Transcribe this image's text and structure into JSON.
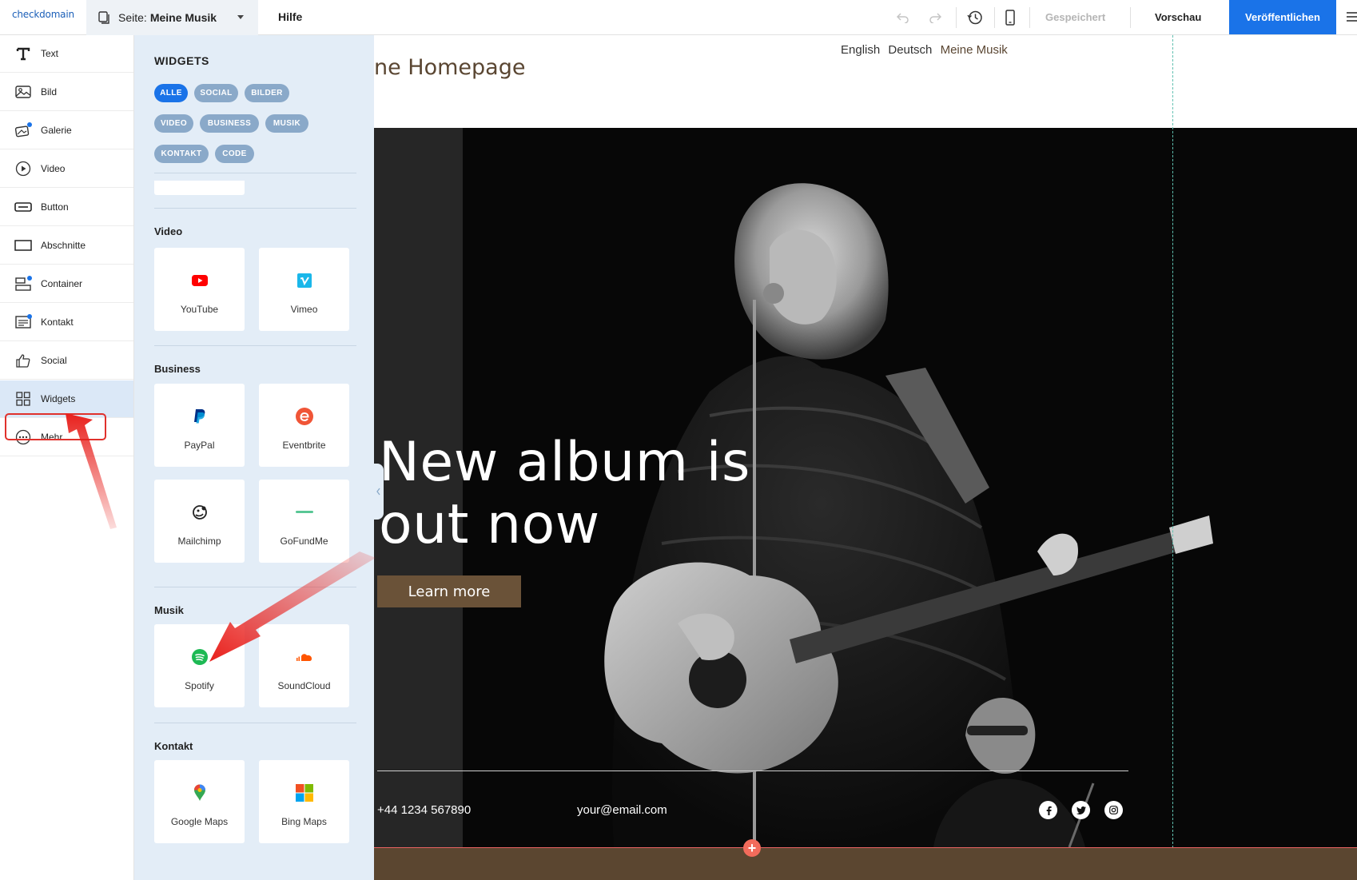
{
  "topbar": {
    "logo": "checkdomain",
    "page_label": "Seite:",
    "page_name": "Meine Musik",
    "help": "Hilfe",
    "saved": "Gespeichert",
    "preview": "Vorschau",
    "publish": "Veröffentlichen"
  },
  "sidebar": {
    "items": [
      {
        "label": "Text",
        "icon": "text-icon"
      },
      {
        "label": "Bild",
        "icon": "image-icon"
      },
      {
        "label": "Galerie",
        "icon": "gallery-icon"
      },
      {
        "label": "Video",
        "icon": "video-icon"
      },
      {
        "label": "Button",
        "icon": "button-icon"
      },
      {
        "label": "Abschnitte",
        "icon": "section-icon"
      },
      {
        "label": "Container",
        "icon": "container-icon"
      },
      {
        "label": "Kontakt",
        "icon": "contact-icon"
      },
      {
        "label": "Social",
        "icon": "thumbs-up-icon"
      },
      {
        "label": "Widgets",
        "icon": "widgets-icon"
      },
      {
        "label": "Mehr",
        "icon": "more-icon"
      }
    ]
  },
  "panel": {
    "title": "WIDGETS",
    "filters": [
      "ALLE",
      "SOCIAL",
      "BILDER",
      "VIDEO",
      "BUSINESS",
      "MUSIK",
      "KONTAKT",
      "CODE"
    ],
    "categories": {
      "video": {
        "title": "Video",
        "items": [
          "YouTube",
          "Vimeo"
        ]
      },
      "business": {
        "title": "Business",
        "items": [
          "PayPal",
          "Eventbrite",
          "Mailchimp",
          "GoFundMe"
        ]
      },
      "musik": {
        "title": "Musik",
        "items": [
          "Spotify",
          "SoundCloud"
        ]
      },
      "kontakt": {
        "title": "Kontakt",
        "items": [
          "Google Maps",
          "Bing Maps"
        ]
      }
    }
  },
  "canvas": {
    "site_title": "ne Homepage",
    "langs": [
      "English",
      "Deutsch",
      "Meine Musik"
    ],
    "headline_line1": "New album is",
    "headline_line2": "out now",
    "cta": "Learn more",
    "phone": "+44 1234 567890",
    "email": "your@email.com",
    "add_symbol": "+"
  },
  "colors": {
    "accent": "#1a73e8",
    "panel_bg": "#e3edf7",
    "chip": "#8aa9c9",
    "brand_brown": "#6a5238",
    "highlight_red": "#e0312c"
  }
}
